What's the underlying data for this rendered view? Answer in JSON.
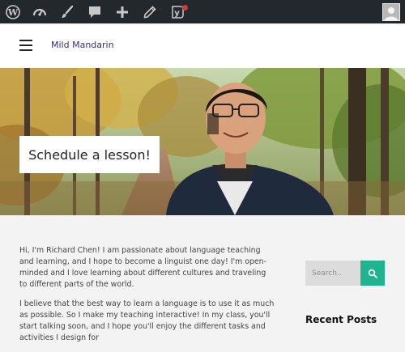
{
  "site": {
    "title": "Mild Mandarin"
  },
  "adminbar": {
    "icons": [
      "wordpress-icon",
      "dashboard-icon",
      "customize-brush-icon",
      "comments-icon",
      "new-plus-icon",
      "edit-pencil-icon",
      "yoast-icon",
      "user-avatar-icon"
    ],
    "notification_color": "#d63638"
  },
  "hero": {
    "cta_label": "Schedule a lesson!"
  },
  "content": {
    "paragraphs": [
      "Hi, I'm Richard Chen! I am passionate about language teaching and learning, and I hope to become a linguist one day! I'm open-minded and I love learning about different cultures and traveling to different parts of the world.",
      "I believe that the best way to learn a language is to use it as much as possible. So I make my teaching interactive! In my class, you'll start talking soon, and I hope you'll enjoy the different tasks and activities I design for"
    ]
  },
  "sidebar": {
    "search_placeholder": "Search..",
    "recent_posts_title": "Recent Posts"
  },
  "colors": {
    "accent": "#20b38f",
    "adminbar": "#23282d",
    "title_link": "#3d2d7a"
  }
}
